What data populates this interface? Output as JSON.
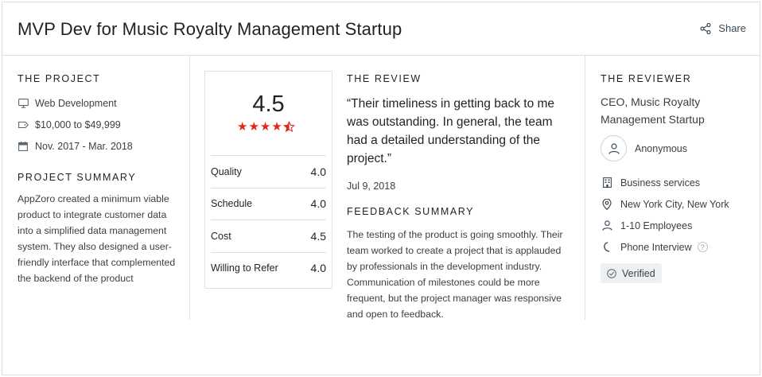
{
  "header": {
    "title": "MVP Dev for Music Royalty Management Startup",
    "share_label": "Share"
  },
  "project": {
    "section_label": "THE PROJECT",
    "facts": [
      {
        "icon": "monitor-icon",
        "text": "Web Development"
      },
      {
        "icon": "price-tag-icon",
        "text": "$10,000 to $49,999"
      },
      {
        "icon": "calendar-icon",
        "text": "Nov. 2017 - Mar. 2018"
      }
    ],
    "summary_label": "PROJECT SUMMARY",
    "summary": "AppZoro created a minimum viable product to integrate customer data into a simplified data management system. They also designed a user-friendly interface that complemented the backend of the product"
  },
  "ratings": {
    "overall": "4.5",
    "stars": 4.5,
    "star_color": "#e62415",
    "rows": [
      {
        "label": "Quality",
        "value": "4.0"
      },
      {
        "label": "Schedule",
        "value": "4.0"
      },
      {
        "label": "Cost",
        "value": "4.5"
      },
      {
        "label": "Willing to Refer",
        "value": "4.0"
      }
    ]
  },
  "review": {
    "section_label": "THE REVIEW",
    "quote": "“Their timeliness in getting back to me was outstanding. In general, the team had a detailed understanding of the project.”",
    "date": "Jul 9, 2018",
    "feedback_label": "FEEDBACK SUMMARY",
    "feedback": "The testing of the product is going smoothly. Their team worked to create a project that is applauded by professionals in the development industry. Communication of milestones could be more frequent, but the project manager was responsive and open to feedback."
  },
  "reviewer": {
    "section_label": "THE REVIEWER",
    "role": "CEO, Music Royalty Management Startup",
    "name": "Anonymous",
    "facts": [
      {
        "icon": "building-icon",
        "text": "Business services"
      },
      {
        "icon": "location-pin-icon",
        "text": "New York City, New York"
      },
      {
        "icon": "person-icon",
        "text": "1-10 Employees"
      },
      {
        "icon": "phone-icon",
        "text": "Phone Interview",
        "help": "?"
      }
    ],
    "verified": "Verified"
  }
}
